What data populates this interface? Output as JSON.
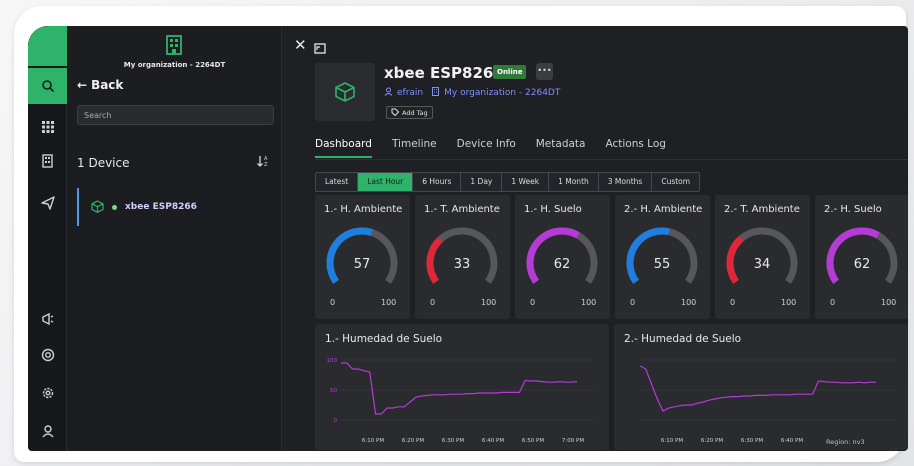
{
  "app": {
    "brand_color": "#2fb36a",
    "accent_blue": "#7f8fff"
  },
  "rail": {
    "icons": [
      "logo-icon",
      "search-icon",
      "grid-icon",
      "building-icon",
      "send-icon",
      "megaphone-icon",
      "help-circle-icon",
      "settings-icon",
      "user-icon"
    ]
  },
  "panel": {
    "org_name": "My organization - 2264DT",
    "back_label": "Back",
    "search_placeholder": "Search",
    "device_count": "1 Device",
    "devices": [
      {
        "name": "xbee ESP8266",
        "status_color": "#7bd88b"
      }
    ]
  },
  "device": {
    "title": "xbee ESP8266",
    "status": "Online",
    "more_label": "•••",
    "owner": "efrain",
    "organization": "My organization - 2264DT",
    "add_tag": "Add Tag"
  },
  "tabs": [
    {
      "label": "Dashboard",
      "active": true
    },
    {
      "label": "Timeline",
      "active": false
    },
    {
      "label": "Device Info",
      "active": false
    },
    {
      "label": "Metadata",
      "active": false
    },
    {
      "label": "Actions Log",
      "active": false
    }
  ],
  "time_ranges": [
    {
      "label": "Latest",
      "active": false
    },
    {
      "label": "Last Hour",
      "active": true
    },
    {
      "label": "6 Hours",
      "active": false
    },
    {
      "label": "1 Day",
      "active": false
    },
    {
      "label": "1 Week",
      "active": false
    },
    {
      "label": "1 Month",
      "active": false
    },
    {
      "label": "3 Months",
      "active": false
    },
    {
      "label": "Custom",
      "active": false
    }
  ],
  "gauges": [
    {
      "title": "1.- H. Ambiente",
      "value": 57,
      "min": "0",
      "max": "100",
      "color": "#1f7fe0"
    },
    {
      "title": "1.- T. Ambiente",
      "value": 33,
      "min": "0",
      "max": "100",
      "color": "#e0273a"
    },
    {
      "title": "1.- H. Suelo",
      "value": 62,
      "min": "0",
      "max": "100",
      "color": "#b53ad6"
    },
    {
      "title": "2.- H. Ambiente",
      "value": 55,
      "min": "0",
      "max": "100",
      "color": "#1f7fe0"
    },
    {
      "title": "2.- T. Ambiente",
      "value": 34,
      "min": "0",
      "max": "100",
      "color": "#e0273a"
    },
    {
      "title": "2.- H. Suelo",
      "value": 62,
      "min": "0",
      "max": "100",
      "color": "#b53ad6"
    }
  ],
  "chart_data": [
    {
      "type": "line",
      "title": "1.- Humedad de Suelo",
      "ylim": [
        0,
        100
      ],
      "yticks": [
        "100",
        "50",
        "0"
      ],
      "x_labels": [
        "6:10 PM",
        "6:20 PM",
        "6:30 PM",
        "6:40 PM",
        "6:50 PM",
        "7:00 PM"
      ],
      "series": [
        {
          "color": "#b53ad6",
          "values": [
            95,
            95,
            85,
            85,
            82,
            80,
            10,
            10,
            20,
            20,
            22,
            22,
            30,
            38,
            40,
            41,
            42,
            42,
            42,
            43,
            43,
            43,
            44,
            44,
            45,
            45,
            45,
            45,
            46,
            46,
            46,
            46,
            66,
            65,
            65,
            64,
            63,
            63,
            64,
            63,
            63,
            64
          ]
        }
      ]
    },
    {
      "type": "line",
      "title": "2.- Humedad de Suelo",
      "ylim": [
        0,
        100
      ],
      "yticks": [],
      "x_labels": [
        "6:10 PM",
        "6:20 PM",
        "6:30 PM",
        "6:40 PM"
      ],
      "footer": "Region: nv3",
      "series": [
        {
          "color": "#b53ad6",
          "values": [
            90,
            85,
            60,
            35,
            15,
            20,
            22,
            24,
            25,
            25,
            28,
            30,
            33,
            35,
            37,
            38,
            39,
            39,
            40,
            40,
            41,
            41,
            41,
            42,
            42,
            42,
            42,
            43,
            43,
            43,
            43,
            65,
            64,
            63,
            63,
            62,
            62,
            62,
            63,
            62,
            63,
            63
          ]
        }
      ]
    }
  ]
}
